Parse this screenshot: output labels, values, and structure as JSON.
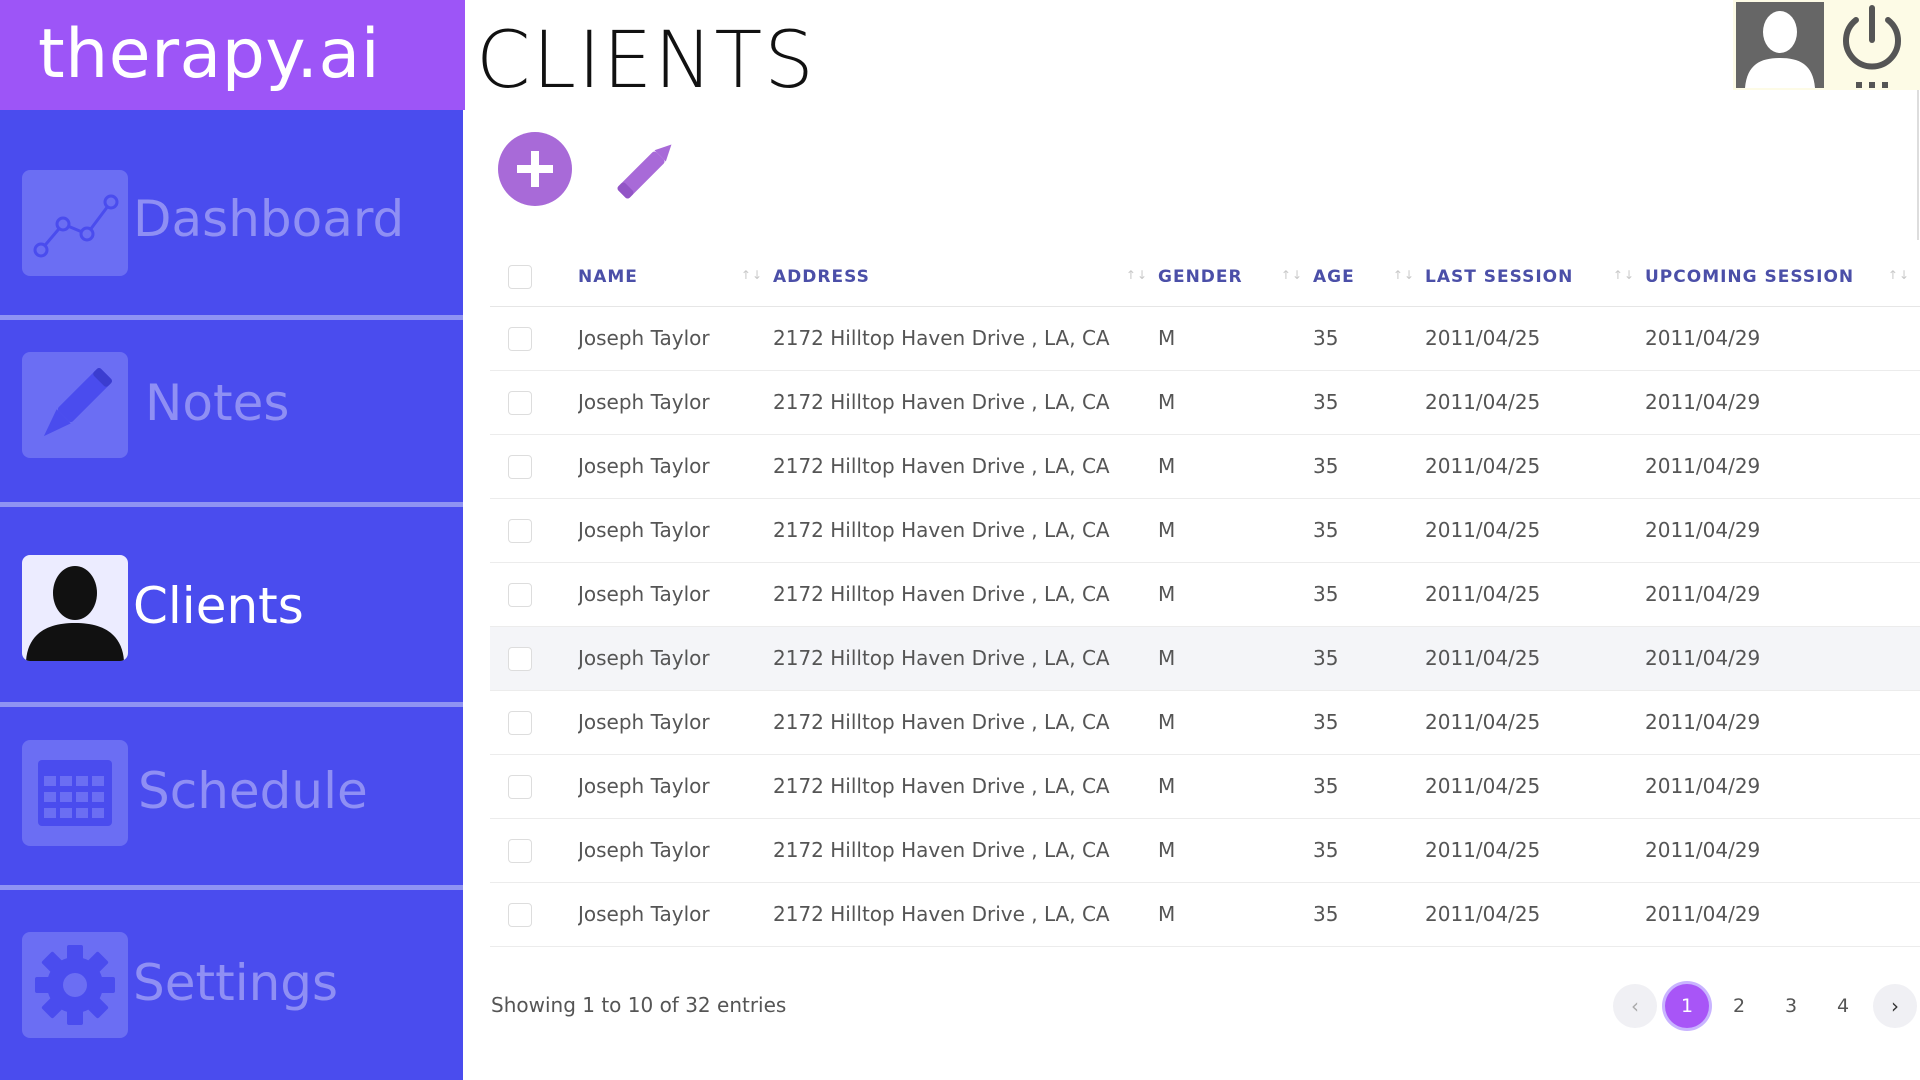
{
  "brand": {
    "name": "therapy.ai"
  },
  "sidebar": {
    "items": [
      {
        "label": "Dashboard",
        "icon": "line-chart-icon",
        "active": false
      },
      {
        "label": "Notes",
        "icon": "pencil-icon",
        "active": false
      },
      {
        "label": "Clients",
        "icon": "person-silhouette-icon",
        "active": true
      },
      {
        "label": "Schedule",
        "icon": "calendar-icon",
        "active": false
      },
      {
        "label": "Settings",
        "icon": "gear-icon",
        "active": false
      }
    ]
  },
  "header": {
    "title": "CLIENTS",
    "profile_icon": "user-icon",
    "power_icon": "power-icon"
  },
  "toolbar": {
    "add_icon": "plus-circle-icon",
    "edit_icon": "pencil-icon"
  },
  "table": {
    "columns": [
      "NAME",
      "ADDRESS",
      "GENDER",
      "AGE",
      "LAST SESSION",
      "UPCOMING SESSION"
    ],
    "rows": [
      [
        "Joseph Taylor",
        "2172 Hilltop Haven Drive , LA, CA",
        "M",
        "35",
        "2011/04/25",
        "2011/04/29"
      ],
      [
        "Joseph Taylor",
        "2172 Hilltop Haven Drive , LA, CA",
        "M",
        "35",
        "2011/04/25",
        "2011/04/29"
      ],
      [
        "Joseph Taylor",
        "2172 Hilltop Haven Drive , LA, CA",
        "M",
        "35",
        "2011/04/25",
        "2011/04/29"
      ],
      [
        "Joseph Taylor",
        "2172 Hilltop Haven Drive , LA, CA",
        "M",
        "35",
        "2011/04/25",
        "2011/04/29"
      ],
      [
        "Joseph Taylor",
        "2172 Hilltop Haven Drive , LA, CA",
        "M",
        "35",
        "2011/04/25",
        "2011/04/29"
      ],
      [
        "Joseph Taylor",
        "2172 Hilltop Haven Drive , LA, CA",
        "M",
        "35",
        "2011/04/25",
        "2011/04/29"
      ],
      [
        "Joseph Taylor",
        "2172 Hilltop Haven Drive , LA, CA",
        "M",
        "35",
        "2011/04/25",
        "2011/04/29"
      ],
      [
        "Joseph Taylor",
        "2172 Hilltop Haven Drive , LA, CA",
        "M",
        "35",
        "2011/04/25",
        "2011/04/29"
      ],
      [
        "Joseph Taylor",
        "2172 Hilltop Haven Drive , LA, CA",
        "M",
        "35",
        "2011/04/25",
        "2011/04/29"
      ],
      [
        "Joseph Taylor",
        "2172 Hilltop Haven Drive , LA, CA",
        "M",
        "35",
        "2011/04/25",
        "2011/04/29"
      ]
    ],
    "highlighted_row": 5
  },
  "footer": {
    "entries_text": "Showing 1 to 10 of 32 entries",
    "pages": [
      "1",
      "2",
      "3",
      "4"
    ],
    "current_page": "1",
    "prev_glyph": "‹",
    "next_glyph": "›"
  },
  "colors": {
    "brand_bg": "#9d55f7",
    "sidebar_bg": "#4a4cee",
    "accent": "#a855f7",
    "header_text": "#4b4fa8"
  }
}
